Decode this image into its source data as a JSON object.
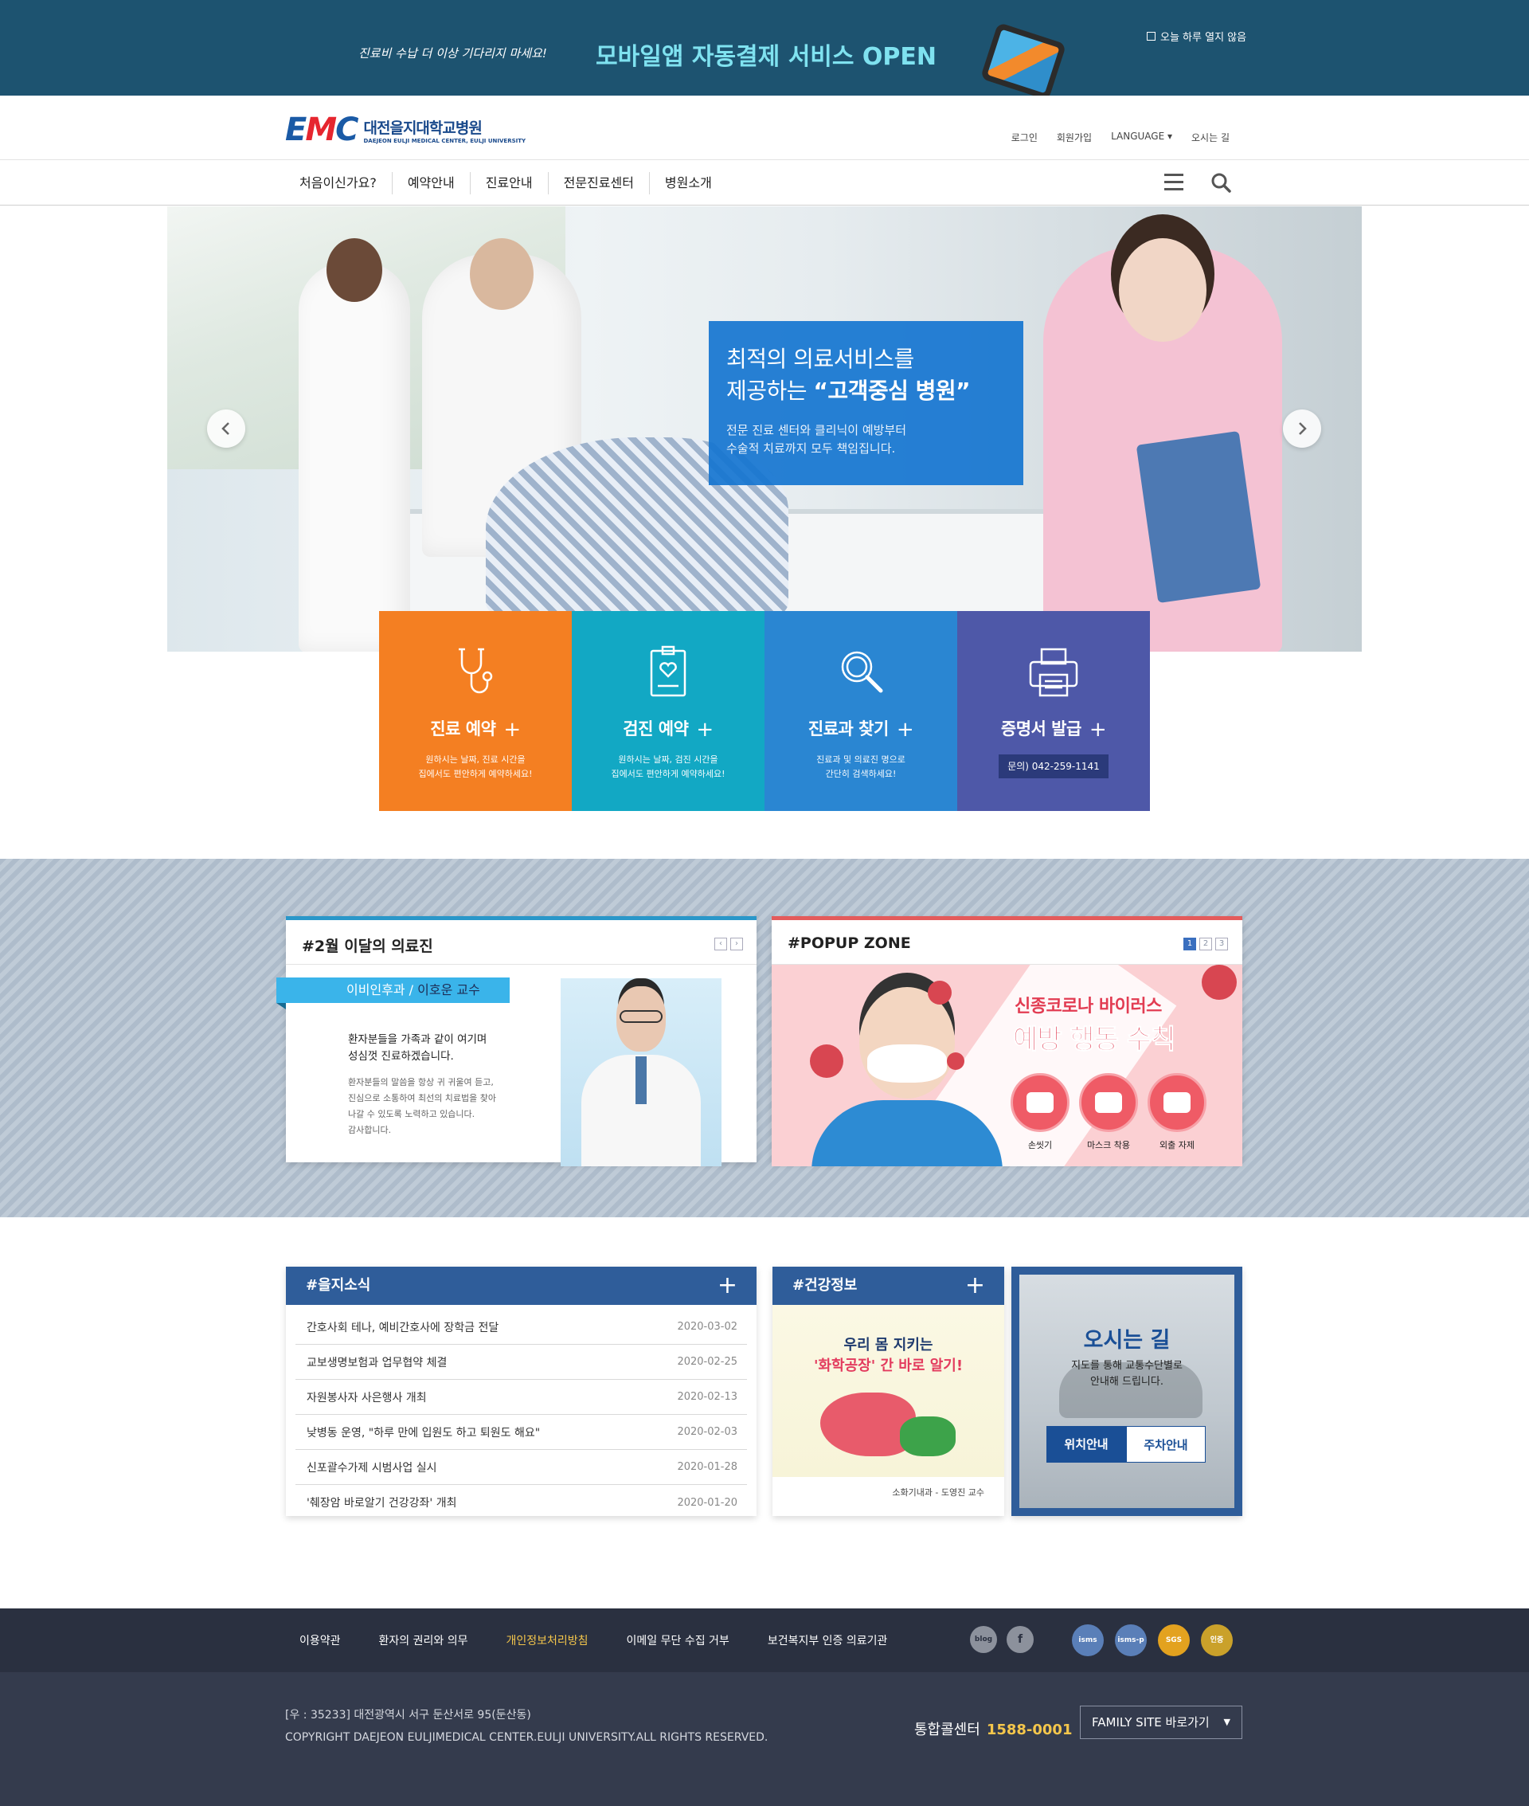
{
  "top_banner": {
    "lead": "진료비 수납 더 이상 기다리지 마세요!",
    "headline": "모바일앱 자동결제 서비스 OPEN",
    "close_label": "오늘 하루 열지 않음"
  },
  "header": {
    "logo_mark": "EMC",
    "logo_kr": "대전을지대학교병원",
    "logo_en": "DAEJEON EULJI MEDICAL CENTER, EULJI UNIVERSITY",
    "util": [
      "로그인",
      "회원가입",
      "LANGUAGE ▾",
      "오시는 길"
    ]
  },
  "gnb": {
    "items": [
      "처음이신가요?",
      "예약안내",
      "진료안내",
      "전문진료센터",
      "병원소개"
    ],
    "icons": [
      "menu-icon",
      "search-icon"
    ]
  },
  "hero": {
    "title_line1": "최적의 의료서비스를",
    "title_line2_pre": "제공하는 ",
    "title_line2_bold": "“고객중심 병원”",
    "desc_line1": "전문 진료 센터와 클리닉이 예방부터",
    "desc_line2": "수술적 치료까지 모두 책임집니다."
  },
  "quick": [
    {
      "title": "진료 예약",
      "line1": "원하시는 날짜, 진료 시간을",
      "line2": "집에서도 편안하게 예약하세요!",
      "color": "#f47f22",
      "icon": "stethoscope-icon"
    },
    {
      "title": "검진 예약",
      "line1": "원하시는 날짜, 검진 시간을",
      "line2": "집에서도 편안하게 예약하세요!",
      "color": "#12a8c4",
      "icon": "clipboard-heart-icon"
    },
    {
      "title": "진료과 찾기",
      "line1": "진료과 및 의료진 명으로",
      "line2": "간단히 검색하세요!",
      "color": "#2a86d2",
      "icon": "magnifier-icon"
    },
    {
      "title": "증명서 발급",
      "phone": "문의) 042-259-1141",
      "color": "#4e58a8",
      "icon": "printer-icon"
    }
  ],
  "doctor": {
    "title": "#2월 이달의 의료진",
    "dept": "이비인후과 / ",
    "name": "이호운 교수",
    "quote1": "환자분들을 가족과 같이 여기며",
    "quote2": "성심껏 진료하겠습니다.",
    "body": [
      "환자분들의 말씀을 항상 귀 귀울여 듣고,",
      "진심으로 소통하여 최선의 치료법을 찾아",
      "나갈 수 있도록 노력하고 있습니다.",
      "감사합니다."
    ]
  },
  "popup": {
    "title": "#POPUP ZONE",
    "pages": [
      "1",
      "2",
      "3"
    ],
    "headline1": "신종코로나 바이러스",
    "headline2": "예방 행동 수칙",
    "tips": [
      "손씻기",
      "마스크 착용",
      "외출 자제"
    ]
  },
  "news": {
    "title": "#을지소식",
    "items": [
      {
        "text": "간호사회 테나, 예비간호사에 장학금 전달",
        "date": "2020-03-02"
      },
      {
        "text": "교보생명보험과 업무협약 체결",
        "date": "2020-02-25"
      },
      {
        "text": "자원봉사자 사은행사 개최",
        "date": "2020-02-13"
      },
      {
        "text": "낮병동 운영, \"하루 만에 입원도 하고 퇴원도 해요\"",
        "date": "2020-02-03"
      },
      {
        "text": "신포괄수가제 시범사업 실시",
        "date": "2020-01-28"
      },
      {
        "text": "'췌장암 바로알기 건강강좌' 개최",
        "date": "2020-01-20"
      }
    ]
  },
  "health": {
    "title": "#건강정보",
    "line1": "우리 몸 지키는",
    "line2": "'화학공장' 간 바로 알기!",
    "caption": "소화기내과 - 도영진 교수"
  },
  "direction": {
    "title": "오시는 길",
    "desc1": "지도를 통해 교통수단별로",
    "desc2": "안내해 드립니다.",
    "btn1": "위치안내",
    "btn2": "주차안내"
  },
  "footer": {
    "links": [
      "이용약관",
      "환자의 권리와 의무",
      "개인정보처리방침",
      "이메일 무단 수집 거부",
      "보건복지부 인증 의료기관"
    ],
    "sns": [
      "blog",
      "f"
    ],
    "certs": [
      "isms",
      "isms-p",
      "SGS",
      "인증"
    ],
    "address": "[우 : 35233] 대전광역시 서구 둔산서로 95(둔산동)",
    "copyright": "COPYRIGHT DAEJEON EULJIMEDICAL CENTER.EULJI UNIVERSITY.ALL RIGHTS RESERVED.",
    "call_label": "통합콜센터",
    "call_number": "1588-0001",
    "family_label": "FAMILY SITE 바로가기"
  }
}
